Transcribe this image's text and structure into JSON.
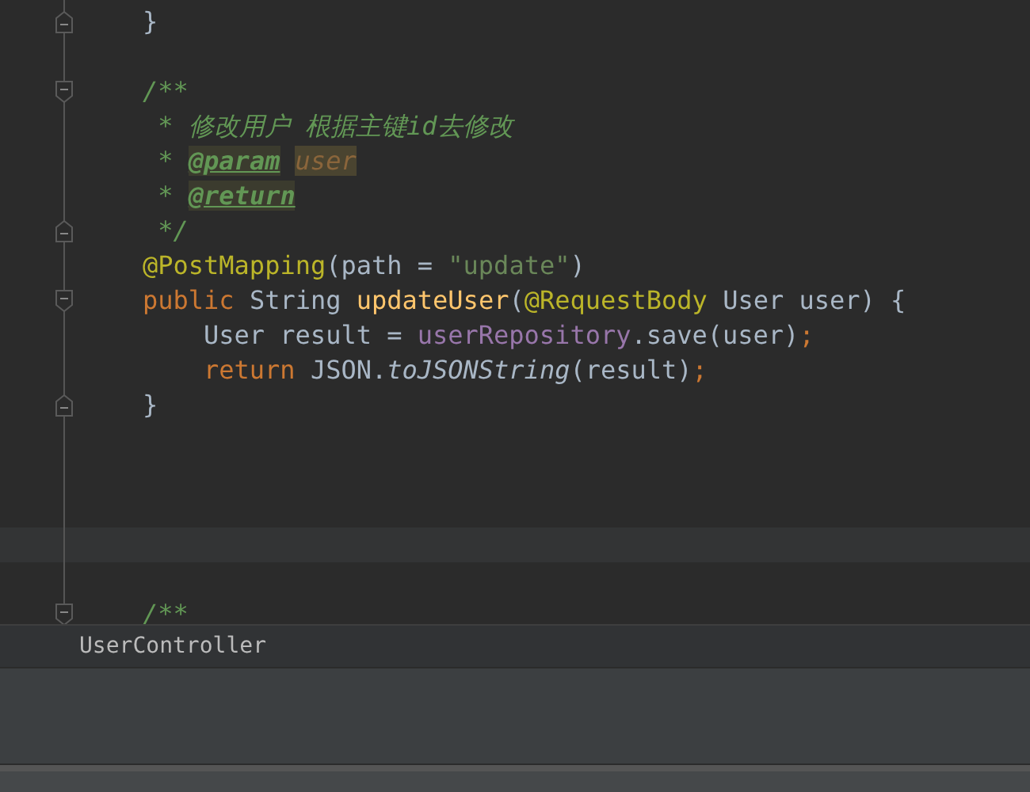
{
  "editor": {
    "lines": [
      {
        "kind": "code",
        "fold_end": true,
        "tokens": [
          {
            "kind": "plain",
            "text": "}"
          }
        ]
      },
      {
        "kind": "blank"
      },
      {
        "kind": "code",
        "fold_start": true,
        "tokens": [
          {
            "kind": "comment",
            "text": "/**"
          }
        ]
      },
      {
        "kind": "code",
        "tokens": [
          {
            "kind": "comment",
            "text": " * 修改用户 根据主键id去修改"
          }
        ]
      },
      {
        "kind": "code",
        "tokens": [
          {
            "kind": "comment",
            "text": " * "
          },
          {
            "kind": "doctag",
            "text": "@param"
          },
          {
            "kind": "docparam",
            "text": "user"
          }
        ]
      },
      {
        "kind": "code",
        "tokens": [
          {
            "kind": "comment",
            "text": " * "
          },
          {
            "kind": "doctag",
            "text": "@return"
          }
        ]
      },
      {
        "kind": "code",
        "fold_end": true,
        "tokens": [
          {
            "kind": "comment",
            "text": " */"
          }
        ]
      },
      {
        "kind": "code",
        "tokens": [
          {
            "kind": "annotation",
            "text": "@PostMapping"
          },
          {
            "kind": "plain",
            "text": "(path = "
          },
          {
            "kind": "string",
            "text": "\"update\""
          },
          {
            "kind": "plain",
            "text": ")"
          }
        ]
      },
      {
        "kind": "code",
        "fold_start": true,
        "tokens": [
          {
            "kind": "keyword",
            "text": "public "
          },
          {
            "kind": "plain",
            "text": "String "
          },
          {
            "kind": "method",
            "text": "updateUser"
          },
          {
            "kind": "plain",
            "text": "("
          },
          {
            "kind": "annotation",
            "text": "@RequestBody "
          },
          {
            "kind": "plain",
            "text": "User user) {"
          }
        ],
        "children": [
          {
            "kind": "code",
            "tokens": [
              {
                "kind": "plain",
                "text": "User result = "
              },
              {
                "kind": "field",
                "text": "userRepository"
              },
              {
                "kind": "plain",
                "text": ".save(user)"
              },
              {
                "kind": "keyword",
                "text": ";"
              }
            ]
          },
          {
            "kind": "code",
            "tokens": [
              {
                "kind": "keyword",
                "text": "return "
              },
              {
                "kind": "plain",
                "text": "JSON."
              },
              {
                "kind": "static",
                "text": "toJSONString"
              },
              {
                "kind": "plain",
                "text": "(result)"
              },
              {
                "kind": "keyword",
                "text": ";"
              }
            ]
          }
        ]
      },
      {
        "kind": "code",
        "fold_end": true,
        "tokens": [
          {
            "kind": "plain",
            "text": "}"
          }
        ]
      },
      {
        "kind": "blank"
      },
      {
        "kind": "blank"
      },
      {
        "kind": "blank"
      },
      {
        "kind": "blank",
        "current": true
      },
      {
        "kind": "blank"
      },
      {
        "kind": "code",
        "fold_start": true,
        "tokens": [
          {
            "kind": "comment",
            "text": "/**"
          }
        ]
      }
    ]
  },
  "breadcrumb": {
    "label": "UserController"
  }
}
